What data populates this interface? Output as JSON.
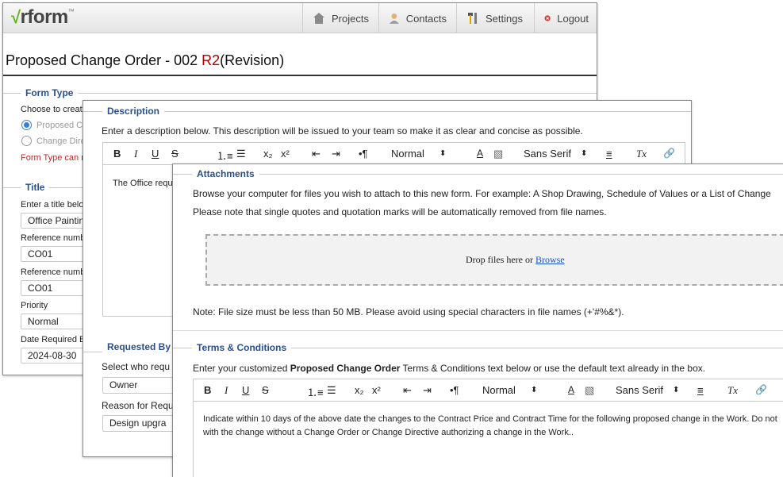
{
  "app": {
    "logo_check": "√",
    "logo_text": "rform",
    "logo_tm": "™"
  },
  "nav": {
    "projects": "Projects",
    "contacts": "Contacts",
    "settings": "Settings",
    "logout": "Logout"
  },
  "page": {
    "title_main": "Proposed Change Order - 002 ",
    "title_rev": "R2",
    "title_suffix": "(Revision)"
  },
  "form_type": {
    "legend": "Form Type",
    "prompt": "Choose to create",
    "option1": "Proposed C",
    "option2": "Change Dire",
    "error": "Form Type can n"
  },
  "title_section": {
    "legend": "Title",
    "title_prompt": "Enter a title belo",
    "title_value": "Office Paintin",
    "ref1_label": "Reference numb",
    "ref1_value": "CO01",
    "ref2_label": "Reference numb",
    "ref2_value": "CO01",
    "priority_label": "Priority",
    "priority_value": "Normal",
    "date_label": "Date Required B",
    "date_value": "2024-08-30"
  },
  "description": {
    "legend": "Description",
    "instructions": "Enter a description below. This description will be issued to your team so make it as clear and concise as possible.",
    "body": "The Office requ"
  },
  "toolbar": {
    "bold": "B",
    "italic": "I",
    "underline": "U",
    "strike": "S",
    "ordered_list": "⒈≡",
    "bullet_list": "☰",
    "subscript": "x₂",
    "superscript": "x²",
    "outdent": "⇤",
    "indent": "⇥",
    "direction": "•¶",
    "size": "Normal",
    "size_arrow": "⬍",
    "color": "A",
    "background": "▧",
    "font": "Sans Serif",
    "font_arrow": "⬍",
    "align": "≡",
    "clear": "Tx",
    "link": "🔗"
  },
  "requested_by": {
    "legend": "Requested By",
    "select_prompt": "Select who requ",
    "select_value": "Owner",
    "reason_label": "Reason for Requ",
    "reason_value": "Design upgra"
  },
  "attachments": {
    "legend": "Attachments",
    "line1": "Browse your computer for files you wish to attach to this new form. For example: A Shop Drawing, Schedule of Values or a List of Change",
    "line2": "Please note that single quotes and quotation marks will be automatically removed from file names.",
    "drop_text": "Drop files here or ",
    "browse_link": "Browse",
    "note": "Note: File size must be less than 50 MB. Please avoid using special characters in file names (+'#%&*)."
  },
  "terms": {
    "legend": "Terms & Conditions",
    "intro_before": "Enter your customized ",
    "intro_bold": "Proposed Change Order",
    "intro_after": " Terms & Conditions text below or use the default text already in the box.",
    "body_line1": "Indicate within 10 days of the above date the changes to the Contract Price and Contract Time for the following proposed change in the Work. Do not",
    "body_line2": "with the change without a Change Order or Change Directive authorizing a change in the Work.."
  },
  "colors": {
    "accent": "#2a4f8a",
    "revision": "#b00000",
    "error": "#d02020",
    "link": "#1a56c8",
    "logo_green": "#6ab023"
  }
}
